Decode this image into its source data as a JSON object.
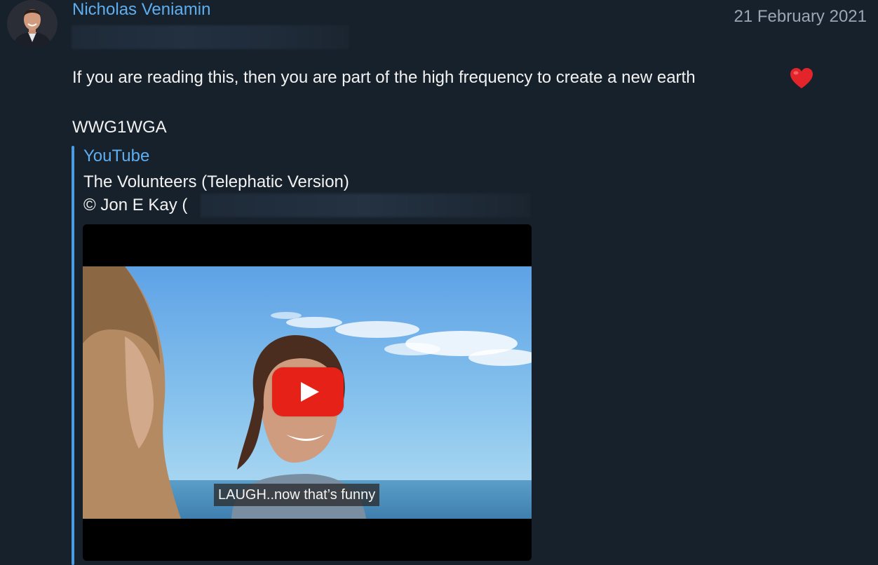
{
  "message": {
    "sender_name": "Nicholas Veniamin",
    "date": "21 February 2021",
    "text_line_1": "If you are reading this, then you are part of the high frequency to create a new earth",
    "text_line_2": "WWG1WGA",
    "heart_icon": "red-heart-emoji"
  },
  "link_preview": {
    "site_name": "YouTube",
    "title": "The Volunteers (Telephatic Version)",
    "description": "© Jon E Kay (",
    "video": {
      "caption": "LAUGH..now that’s funny",
      "play_icon": "play-icon",
      "play_color": "#e62117"
    }
  },
  "colors": {
    "background": "#17212b",
    "accent": "#5eaef0",
    "text": "#f2f2f2",
    "date": "#9aa6b3"
  }
}
